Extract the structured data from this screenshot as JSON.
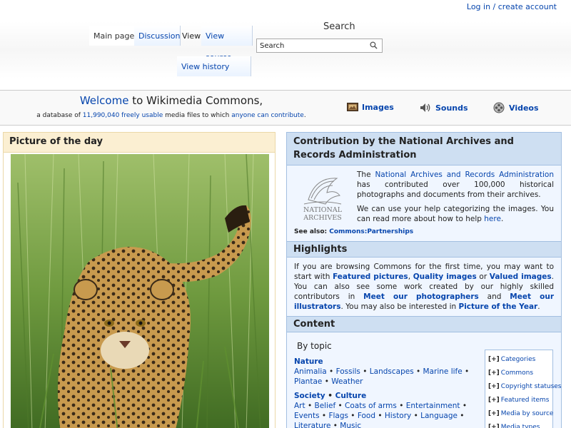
{
  "personal": {
    "login_label": "Log in / create account"
  },
  "tabs": {
    "main_page": "Main page",
    "discussion": "Discussion",
    "view": "View",
    "view_source": "View source",
    "view_history": "View history"
  },
  "search": {
    "title": "Search",
    "placeholder": "Search",
    "icon": "magnifier-icon"
  },
  "welcome": {
    "welcome_word": "Welcome",
    "to_text": " to Wikimedia Commons,",
    "line2_prefix": "a database of ",
    "count_link": "11,990,040 freely usable",
    "line2_mid": " media files to which ",
    "contribute_link": "anyone can contribute",
    "line2_suffix": "."
  },
  "media_links": [
    {
      "label": "Images",
      "icon": "images-icon"
    },
    {
      "label": "Sounds",
      "icon": "sounds-icon"
    },
    {
      "label": "Videos",
      "icon": "videos-icon"
    }
  ],
  "potd": {
    "title": "Picture of the day",
    "image_subject": "leopard"
  },
  "contribution": {
    "title": "Contribution by the National Archives and Records Administration",
    "p1_pre": "The ",
    "p1_link": "National Archives and Records Administration",
    "p1_post": " has contributed over 100,000 historical photographs and documents from their archives.",
    "p2_pre": "We can use your help categorizing the images. You can read more about how to help ",
    "p2_link": "here",
    "p2_post": ".",
    "see_also_label": "See also: ",
    "see_also_link": "Commons:Partnerships",
    "logo_text_1": "NATIONAL",
    "logo_text_2": "ARCHIVES"
  },
  "highlights": {
    "title": "Highlights",
    "t1": "If you are browsing Commons for the first time, you may want to start with ",
    "l1": "Featured pictures",
    "t2": ", ",
    "l2": "Quality images",
    "t3": " or ",
    "l3": "Valued images",
    "t4": ". You can also see some work created by our highly skilled contributors in ",
    "l4": "Meet our photographers",
    "t5": " and ",
    "l5": "Meet our illustrators",
    "t6": ". You may also be interested in ",
    "l6": "Picture of the Year",
    "t7": "."
  },
  "content": {
    "title": "Content",
    "by_topic": "By topic",
    "nature_head": "Nature",
    "nature_items": [
      "Animalia",
      "Fossils",
      "Landscapes",
      "Marine life",
      "Plantae",
      "Weather"
    ],
    "society_head": "Society",
    "culture_head": "Culture",
    "society_items": [
      "Art",
      "Belief",
      "Coats of arms",
      "Entertainment",
      "Events",
      "Flags",
      "Food",
      "History",
      "Language",
      "Literature",
      "Music"
    ],
    "toc": [
      "Categories",
      "Commons",
      "Copyright statuses",
      "Featured items",
      "Media by source",
      "Media types"
    ],
    "toc_marker": "[+]"
  },
  "colors": {
    "link": "#0645ad",
    "potd_header": "#fbefd2",
    "right_header": "#cedff2",
    "right_bg": "#f0f6ff"
  }
}
